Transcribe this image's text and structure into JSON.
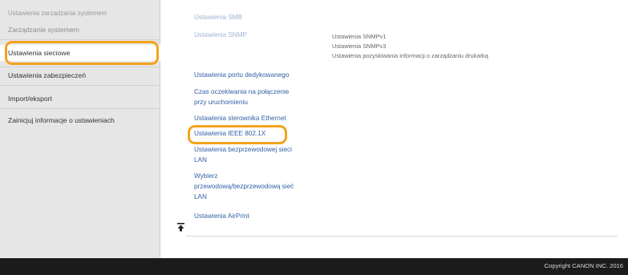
{
  "sidebar": {
    "section_title": "Ustawienia zarządzania systemem",
    "items": [
      {
        "label": "Zarządzanie systemem"
      },
      {
        "label": "Ustawienia sieciowe"
      },
      {
        "label": "Ustawienia zabezpieczeń"
      },
      {
        "label": "Import/eksport"
      },
      {
        "label": "Zainicjuj informacje o ustawieniach"
      }
    ]
  },
  "main": {
    "links": [
      {
        "label": "Ustawienia SMB"
      },
      {
        "label": "Ustawienia SNMP"
      },
      {
        "label": "Ustawienia portu dedykowanego"
      },
      {
        "label": "Czas oczekiwania na połączenie"
      },
      {
        "label": "przy uruchomieniu"
      },
      {
        "label": "Ustawienia sterownika Ethernet"
      },
      {
        "label": "Ustawienia IEEE 802.1X"
      },
      {
        "label": "Ustawienia bezprzewodowej sieci"
      },
      {
        "label": "LAN"
      },
      {
        "label": "Wybierz"
      },
      {
        "label": "przewodową/bezprzewodową sieć"
      },
      {
        "label": "LAN"
      },
      {
        "label": "Ustawienia AirPrint"
      }
    ],
    "snmp_info": [
      "Ustawienia SNMPv1",
      "Ustawienia SNMPv3",
      "Ustawienia pozyskiwania informacji o zarządzaniu drukarką"
    ]
  },
  "footer": {
    "copyright": "Copyright CANON INC. 2016"
  },
  "colors": {
    "highlight": "#f4a21f",
    "link": "#3360a6",
    "footer_bg": "#1b1b1b"
  },
  "icons": {
    "back_to_top": "up-arrow-to-top-icon"
  }
}
